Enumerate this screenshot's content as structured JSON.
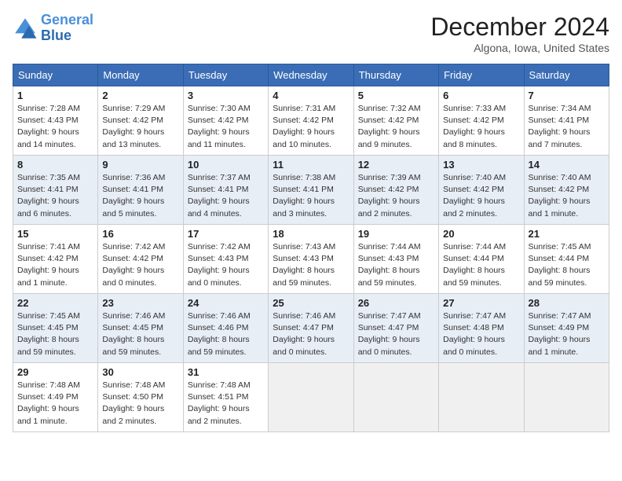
{
  "header": {
    "logo_line1": "General",
    "logo_line2": "Blue",
    "month": "December 2024",
    "location": "Algona, Iowa, United States"
  },
  "days_of_week": [
    "Sunday",
    "Monday",
    "Tuesday",
    "Wednesday",
    "Thursday",
    "Friday",
    "Saturday"
  ],
  "weeks": [
    [
      {
        "day": 1,
        "sunrise": "7:28 AM",
        "sunset": "4:43 PM",
        "daylight": "9 hours and 14 minutes."
      },
      {
        "day": 2,
        "sunrise": "7:29 AM",
        "sunset": "4:42 PM",
        "daylight": "9 hours and 13 minutes."
      },
      {
        "day": 3,
        "sunrise": "7:30 AM",
        "sunset": "4:42 PM",
        "daylight": "9 hours and 11 minutes."
      },
      {
        "day": 4,
        "sunrise": "7:31 AM",
        "sunset": "4:42 PM",
        "daylight": "9 hours and 10 minutes."
      },
      {
        "day": 5,
        "sunrise": "7:32 AM",
        "sunset": "4:42 PM",
        "daylight": "9 hours and 9 minutes."
      },
      {
        "day": 6,
        "sunrise": "7:33 AM",
        "sunset": "4:42 PM",
        "daylight": "9 hours and 8 minutes."
      },
      {
        "day": 7,
        "sunrise": "7:34 AM",
        "sunset": "4:41 PM",
        "daylight": "9 hours and 7 minutes."
      }
    ],
    [
      {
        "day": 8,
        "sunrise": "7:35 AM",
        "sunset": "4:41 PM",
        "daylight": "9 hours and 6 minutes."
      },
      {
        "day": 9,
        "sunrise": "7:36 AM",
        "sunset": "4:41 PM",
        "daylight": "9 hours and 5 minutes."
      },
      {
        "day": 10,
        "sunrise": "7:37 AM",
        "sunset": "4:41 PM",
        "daylight": "9 hours and 4 minutes."
      },
      {
        "day": 11,
        "sunrise": "7:38 AM",
        "sunset": "4:41 PM",
        "daylight": "9 hours and 3 minutes."
      },
      {
        "day": 12,
        "sunrise": "7:39 AM",
        "sunset": "4:42 PM",
        "daylight": "9 hours and 2 minutes."
      },
      {
        "day": 13,
        "sunrise": "7:40 AM",
        "sunset": "4:42 PM",
        "daylight": "9 hours and 2 minutes."
      },
      {
        "day": 14,
        "sunrise": "7:40 AM",
        "sunset": "4:42 PM",
        "daylight": "9 hours and 1 minute."
      }
    ],
    [
      {
        "day": 15,
        "sunrise": "7:41 AM",
        "sunset": "4:42 PM",
        "daylight": "9 hours and 1 minute."
      },
      {
        "day": 16,
        "sunrise": "7:42 AM",
        "sunset": "4:42 PM",
        "daylight": "9 hours and 0 minutes."
      },
      {
        "day": 17,
        "sunrise": "7:42 AM",
        "sunset": "4:43 PM",
        "daylight": "9 hours and 0 minutes."
      },
      {
        "day": 18,
        "sunrise": "7:43 AM",
        "sunset": "4:43 PM",
        "daylight": "8 hours and 59 minutes."
      },
      {
        "day": 19,
        "sunrise": "7:44 AM",
        "sunset": "4:43 PM",
        "daylight": "8 hours and 59 minutes."
      },
      {
        "day": 20,
        "sunrise": "7:44 AM",
        "sunset": "4:44 PM",
        "daylight": "8 hours and 59 minutes."
      },
      {
        "day": 21,
        "sunrise": "7:45 AM",
        "sunset": "4:44 PM",
        "daylight": "8 hours and 59 minutes."
      }
    ],
    [
      {
        "day": 22,
        "sunrise": "7:45 AM",
        "sunset": "4:45 PM",
        "daylight": "8 hours and 59 minutes."
      },
      {
        "day": 23,
        "sunrise": "7:46 AM",
        "sunset": "4:45 PM",
        "daylight": "8 hours and 59 minutes."
      },
      {
        "day": 24,
        "sunrise": "7:46 AM",
        "sunset": "4:46 PM",
        "daylight": "8 hours and 59 minutes."
      },
      {
        "day": 25,
        "sunrise": "7:46 AM",
        "sunset": "4:47 PM",
        "daylight": "9 hours and 0 minutes."
      },
      {
        "day": 26,
        "sunrise": "7:47 AM",
        "sunset": "4:47 PM",
        "daylight": "9 hours and 0 minutes."
      },
      {
        "day": 27,
        "sunrise": "7:47 AM",
        "sunset": "4:48 PM",
        "daylight": "9 hours and 0 minutes."
      },
      {
        "day": 28,
        "sunrise": "7:47 AM",
        "sunset": "4:49 PM",
        "daylight": "9 hours and 1 minute."
      }
    ],
    [
      {
        "day": 29,
        "sunrise": "7:48 AM",
        "sunset": "4:49 PM",
        "daylight": "9 hours and 1 minute."
      },
      {
        "day": 30,
        "sunrise": "7:48 AM",
        "sunset": "4:50 PM",
        "daylight": "9 hours and 2 minutes."
      },
      {
        "day": 31,
        "sunrise": "7:48 AM",
        "sunset": "4:51 PM",
        "daylight": "9 hours and 2 minutes."
      },
      null,
      null,
      null,
      null
    ]
  ]
}
